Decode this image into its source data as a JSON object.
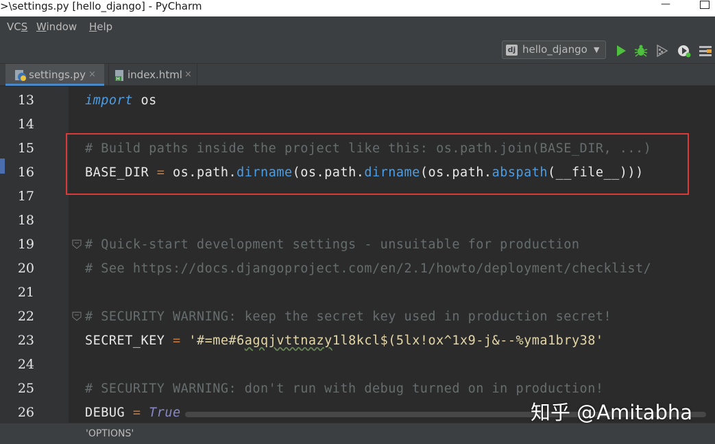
{
  "window": {
    "title": ">\\settings.py [hello_django] - PyCharm",
    "minimize_glyph": "—",
    "maximize_glyph": ""
  },
  "menubar": {
    "items": [
      {
        "label": "VCS",
        "mnemonic": "S"
      },
      {
        "label": "Window",
        "mnemonic": "W"
      },
      {
        "label": "Help",
        "mnemonic": "H"
      }
    ]
  },
  "toolbar": {
    "run_config": {
      "icon_text": "dj",
      "label": "hello_django",
      "arrow": "▼"
    },
    "buttons": [
      "run-icon",
      "debug-icon",
      "coverage-icon",
      "profile-icon",
      "stop-icon"
    ],
    "accent_run": "#4fbf40"
  },
  "tabs": [
    {
      "label": "settings.py",
      "close": "×",
      "active": true,
      "icon": "python-file-icon"
    },
    {
      "label": "index.html",
      "close": "×",
      "active": false,
      "icon": "html-file-icon"
    }
  ],
  "editor": {
    "lines": [
      {
        "no": "13",
        "segments": [
          {
            "text": "import",
            "type": "kw"
          },
          {
            "text": " os",
            "type": "plain"
          }
        ]
      },
      {
        "no": "14",
        "segments": []
      },
      {
        "no": "15",
        "segments": [
          {
            "text": "# Build paths inside the project like this: os.path.join(BASE_DIR, ...)",
            "type": "cmt"
          }
        ]
      },
      {
        "no": "16",
        "segments": [
          {
            "text": "BASE_DIR ",
            "type": "plain"
          },
          {
            "text": "=",
            "type": "op"
          },
          {
            "text": " os.path.",
            "type": "plain"
          },
          {
            "text": "dirname",
            "type": "fn"
          },
          {
            "text": "(os.path.",
            "type": "plain"
          },
          {
            "text": "dirname",
            "type": "fn"
          },
          {
            "text": "(os.path.",
            "type": "plain"
          },
          {
            "text": "abspath",
            "type": "fn"
          },
          {
            "text": "(__file__)))",
            "type": "plain"
          }
        ]
      },
      {
        "no": "17",
        "segments": []
      },
      {
        "no": "18",
        "segments": []
      },
      {
        "no": "19",
        "segments": [
          {
            "text": "# Quick-start development settings - unsuitable for production",
            "type": "cmt"
          }
        ],
        "fold": true
      },
      {
        "no": "20",
        "segments": [
          {
            "text": "# See https://docs.djangoproject.com/en/2.1/howto/deployment/checklist/",
            "type": "cmt"
          }
        ]
      },
      {
        "no": "21",
        "segments": []
      },
      {
        "no": "22",
        "segments": [
          {
            "text": "# SECURITY WARNING: keep the secret key used in production secret!",
            "type": "cmt"
          }
        ],
        "fold": true
      },
      {
        "no": "23",
        "segments": [
          {
            "text": "SECRET_KEY ",
            "type": "plain"
          },
          {
            "text": "=",
            "type": "op"
          },
          {
            "text": " '#=me#6",
            "type": "str"
          },
          {
            "text": "agqjvttnazy",
            "type": "str squig"
          },
          {
            "text": "1l8kcl$(5lx!ox^1x9-j&--%yma1bry38'",
            "type": "str"
          }
        ]
      },
      {
        "no": "24",
        "segments": []
      },
      {
        "no": "25",
        "segments": [
          {
            "text": "# SECURITY WARNING: don't run with debug turned on in production!",
            "type": "cmt"
          }
        ]
      },
      {
        "no": "26",
        "segments": [
          {
            "text": "DEBUG ",
            "type": "plain"
          },
          {
            "text": "=",
            "type": "op"
          },
          {
            "text": " ",
            "type": "plain"
          },
          {
            "text": "True",
            "type": "kw-true"
          }
        ]
      }
    ]
  },
  "breadcrumb": "'OPTIONS'",
  "watermark": "知乎 @Amitabha",
  "colors": {
    "highlight_box": "#d93a3a",
    "active_tab_underline": "#4a88c7"
  }
}
